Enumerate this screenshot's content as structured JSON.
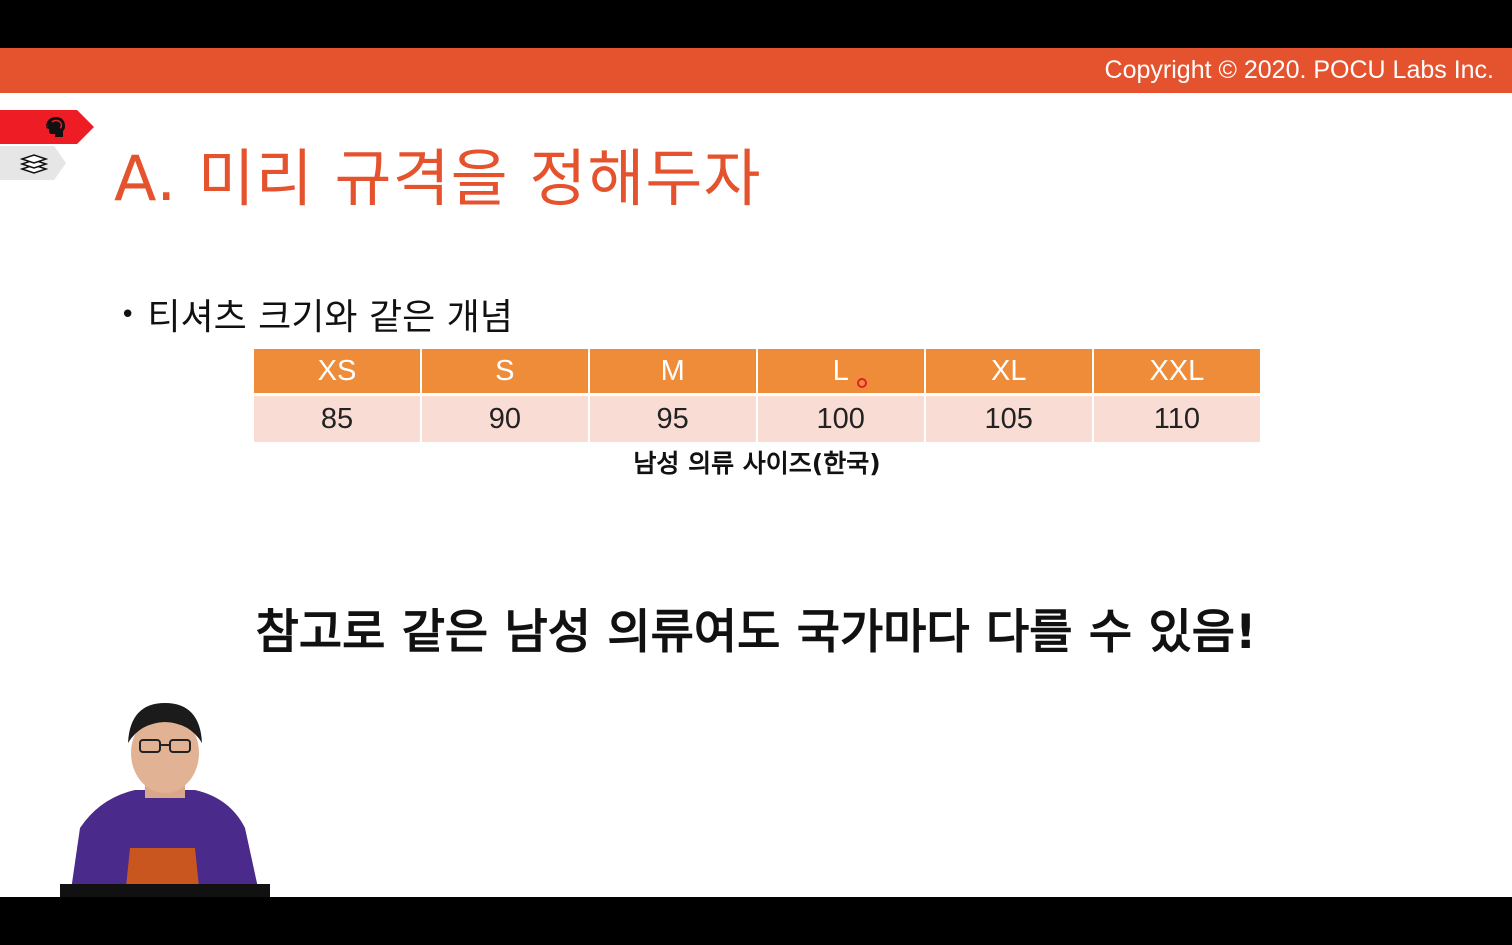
{
  "header": {
    "copyright": "Copyright © 2020. POCU Labs Inc."
  },
  "side_tabs": [
    {
      "icon": "brain-head-icon"
    },
    {
      "icon": "book-stack-icon"
    }
  ],
  "slide": {
    "title": "A. 미리 규격을 정해두자",
    "bullet": "티셔츠 크기와 같은 개념",
    "table": {
      "headers": [
        "XS",
        "S",
        "M",
        "L",
        "XL",
        "XXL"
      ],
      "values": [
        "85",
        "90",
        "95",
        "100",
        "105",
        "110"
      ]
    },
    "caption": "남성 의류 사이즈(한국)",
    "note": "참고로 같은 남성 의류여도 국가마다 다를 수 있음!"
  },
  "colors": {
    "accent": "#e5532e",
    "table_header": "#ef8c3a",
    "table_row": "#f9dcd4"
  }
}
